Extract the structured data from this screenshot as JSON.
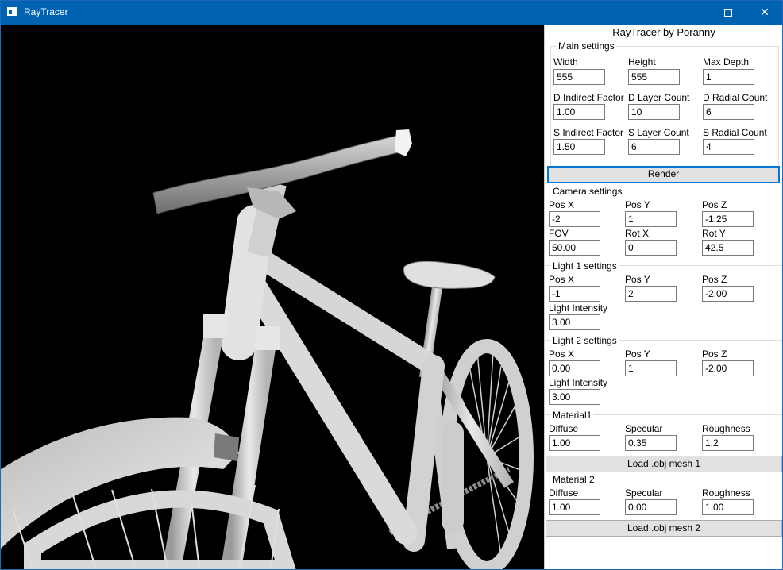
{
  "window": {
    "title": "RayTracer",
    "min_glyph": "—",
    "close_glyph": "✕"
  },
  "panel": {
    "title": "RayTracer by Poranny",
    "main": {
      "label": "Main settings",
      "width_label": "Width",
      "width": "555",
      "height_label": "Height",
      "height": "555",
      "maxdepth_label": "Max Depth",
      "maxdepth": "1",
      "d_indirect_label": "D Indirect Factor",
      "d_indirect": "1.00",
      "d_layer_label": "D Layer Count",
      "d_layer": "10",
      "d_radial_label": "D Radial Count",
      "d_radial": "6",
      "s_indirect_label": "S Indirect Factor",
      "s_indirect": "1.50",
      "s_layer_label": "S Layer Count",
      "s_layer": "6",
      "s_radial_label": "S Radial Count",
      "s_radial": "4"
    },
    "render_label": "Render",
    "camera": {
      "label": "Camera settings",
      "posx_label": "Pos X",
      "posx": "-2",
      "posy_label": "Pos Y",
      "posy": "1",
      "posz_label": "Pos Z",
      "posz": "-1.25",
      "fov_label": "FOV",
      "fov": "50.00",
      "rotx_label": "Rot X",
      "rotx": "0",
      "roty_label": "Rot Y",
      "roty": "42.5"
    },
    "light1": {
      "label": "Light 1 settings",
      "posx_label": "Pos X",
      "posx": "-1",
      "posy_label": "Pos Y",
      "posy": "2",
      "posz_label": "Pos Z",
      "posz": "-2.00",
      "intensity_label": "Light Intensity",
      "intensity": "3.00"
    },
    "light2": {
      "label": "Light 2 settings",
      "posx_label": "Pos X",
      "posx": "0.00",
      "posy_label": "Pos Y",
      "posy": "1",
      "posz_label": "Pos Z",
      "posz": "-2.00",
      "intensity_label": "Light Intensity",
      "intensity": "3.00"
    },
    "material1": {
      "label": "Material1",
      "diffuse_label": "Diffuse",
      "diffuse": "1.00",
      "specular_label": "Specular",
      "specular": "0.35",
      "roughness_label": "Roughness",
      "roughness": "1.2"
    },
    "load1_label": "Load .obj mesh 1",
    "material2": {
      "label": "Material 2",
      "diffuse_label": "Diffuse",
      "diffuse": "1.00",
      "specular_label": "Specular",
      "specular": "0.00",
      "roughness_label": "Roughness",
      "roughness": "1.00"
    },
    "load2_label": "Load .obj mesh 2"
  }
}
